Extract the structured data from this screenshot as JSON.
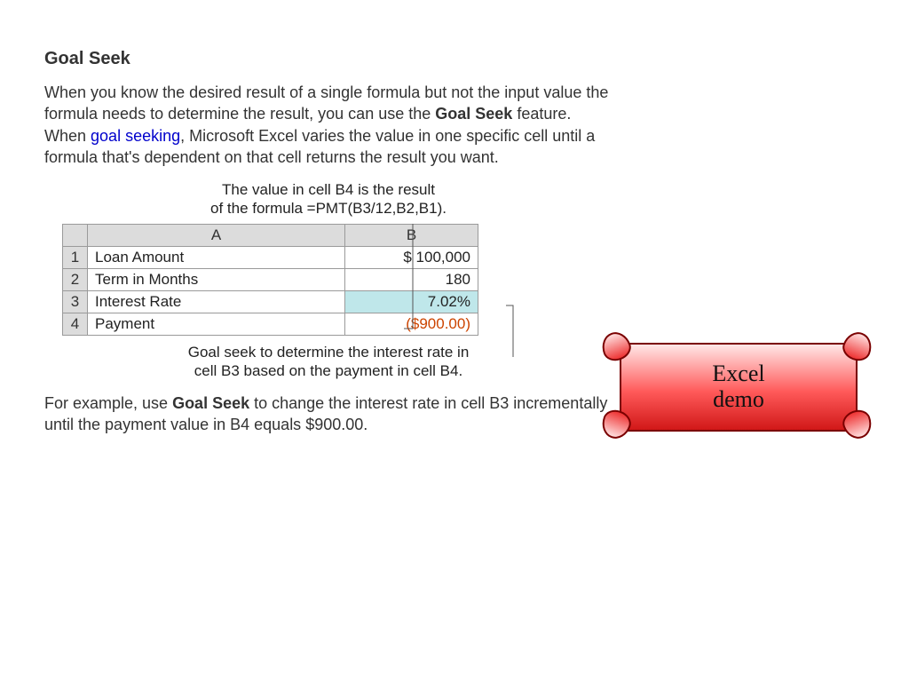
{
  "title": "Goal Seek",
  "para1_parts": {
    "t1": "When you know the desired result of a single formula but not the input value the formula needs to determine the result, you can use the ",
    "bold": "Goal Seek",
    "t2": " feature. When ",
    "link": "goal seeking",
    "t3": ", Microsoft Excel varies the value in one specific cell until a formula that's dependent on that cell returns the result you want."
  },
  "callout_top_line1": "The value in cell B4 is the result",
  "callout_top_line2": "of the formula =PMT(B3/12,B2,B1).",
  "sheet": {
    "colA": "A",
    "colB": "B",
    "rows": [
      {
        "n": "1",
        "label": "Loan Amount",
        "value": "$ 100,000",
        "highlight": false,
        "neg": false
      },
      {
        "n": "2",
        "label": "Term in Months",
        "value": "180",
        "highlight": false,
        "neg": false
      },
      {
        "n": "3",
        "label": "Interest Rate",
        "value": "7.02%",
        "highlight": true,
        "neg": false
      },
      {
        "n": "4",
        "label": "Payment",
        "value": "($900.00)",
        "highlight": false,
        "neg": true
      }
    ]
  },
  "callout_bottom_line1": "Goal seek to determine the interest rate in",
  "callout_bottom_line2": "cell B3 based on the payment in cell B4.",
  "para2_parts": {
    "t1": "For example, use ",
    "bold": "Goal Seek",
    "t2": " to change the interest rate in cell B3 incrementally until the payment value in B4 equals $900.00."
  },
  "scroll": {
    "line1": "Excel",
    "line2": "demo"
  }
}
